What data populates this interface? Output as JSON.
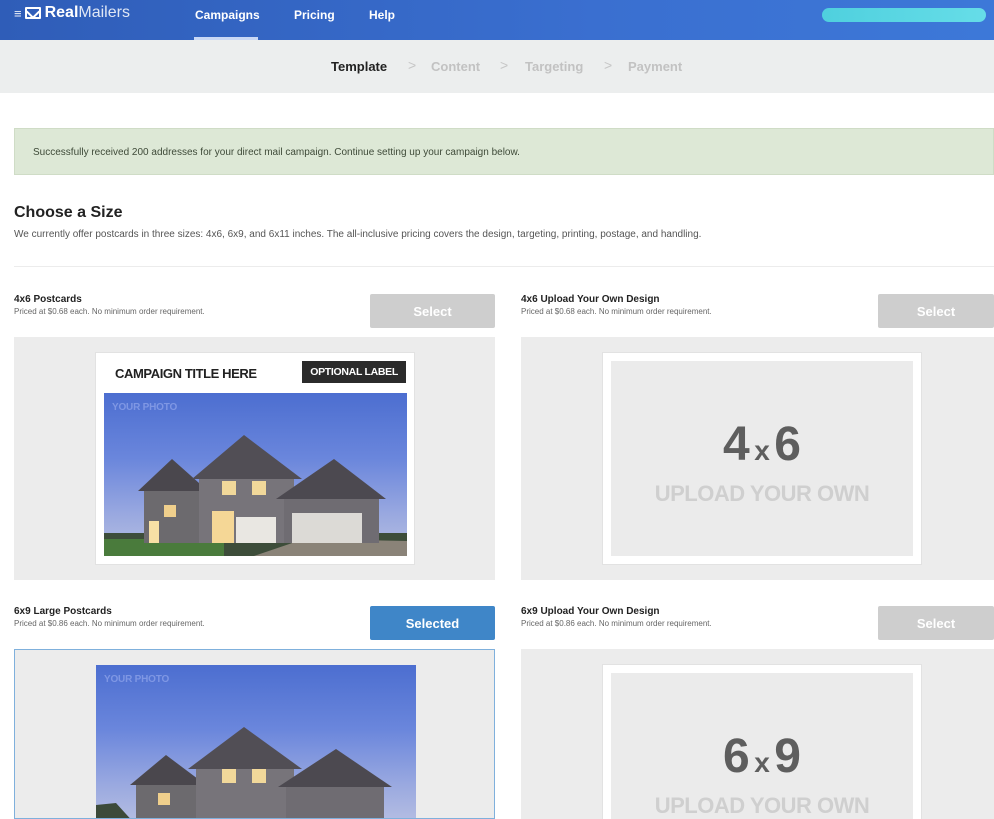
{
  "navbar": {
    "logo_prefix": "≡",
    "logo_bold": "Real",
    "logo_light": "Mailers",
    "links": [
      "Campaigns",
      "Pricing",
      "Help"
    ]
  },
  "steps": {
    "items": [
      "Template",
      "Content",
      "Targeting",
      "Payment"
    ],
    "separator": ">"
  },
  "alert": {
    "message": "Successfully received 200 addresses for your direct mail campaign. Continue setting up your campaign below."
  },
  "section": {
    "title": "Choose a Size",
    "description": "We currently offer postcards in three sizes: 4x6, 6x9, and 6x11 inches. The all-inclusive pricing covers the design, targeting, printing, postage, and handling."
  },
  "options": [
    {
      "title": "4x6 Postcards",
      "subtitle": "Priced at $0.68 each. No minimum order requirement.",
      "button": "Select",
      "selected": false
    },
    {
      "title": "4x6 Upload Your Own Design",
      "subtitle": "Priced at $0.68 each. No minimum order requirement.",
      "button": "Select",
      "selected": false
    },
    {
      "title": "6x9 Large Postcards",
      "subtitle": "Priced at $0.86 each. No minimum order requirement.",
      "button": "Selected",
      "selected": true
    },
    {
      "title": "6x9 Upload Your Own Design",
      "subtitle": "Priced at $0.86 each. No minimum order requirement.",
      "button": "Select",
      "selected": false
    }
  ],
  "preview": {
    "campaign_title": "CAMPAIGN TITLE HERE",
    "optional_label": "OPTIONAL LABEL",
    "photo_label": "YOUR PHOTO",
    "upload_4x6_a": "4",
    "upload_4x6_x": "x",
    "upload_4x6_b": "6",
    "upload_6x9_a": "6",
    "upload_6x9_x": "x",
    "upload_6x9_b": "9",
    "upload_text": "UPLOAD YOUR OWN"
  },
  "carousel": {
    "prev_icon": "chevron-left-icon",
    "next_icon": "chevron-right-icon"
  },
  "colors": {
    "navbar": "#3464c4",
    "selected_button": "#3f86c8",
    "inactive_button": "#cecece",
    "alert_bg": "#dde8d6"
  }
}
